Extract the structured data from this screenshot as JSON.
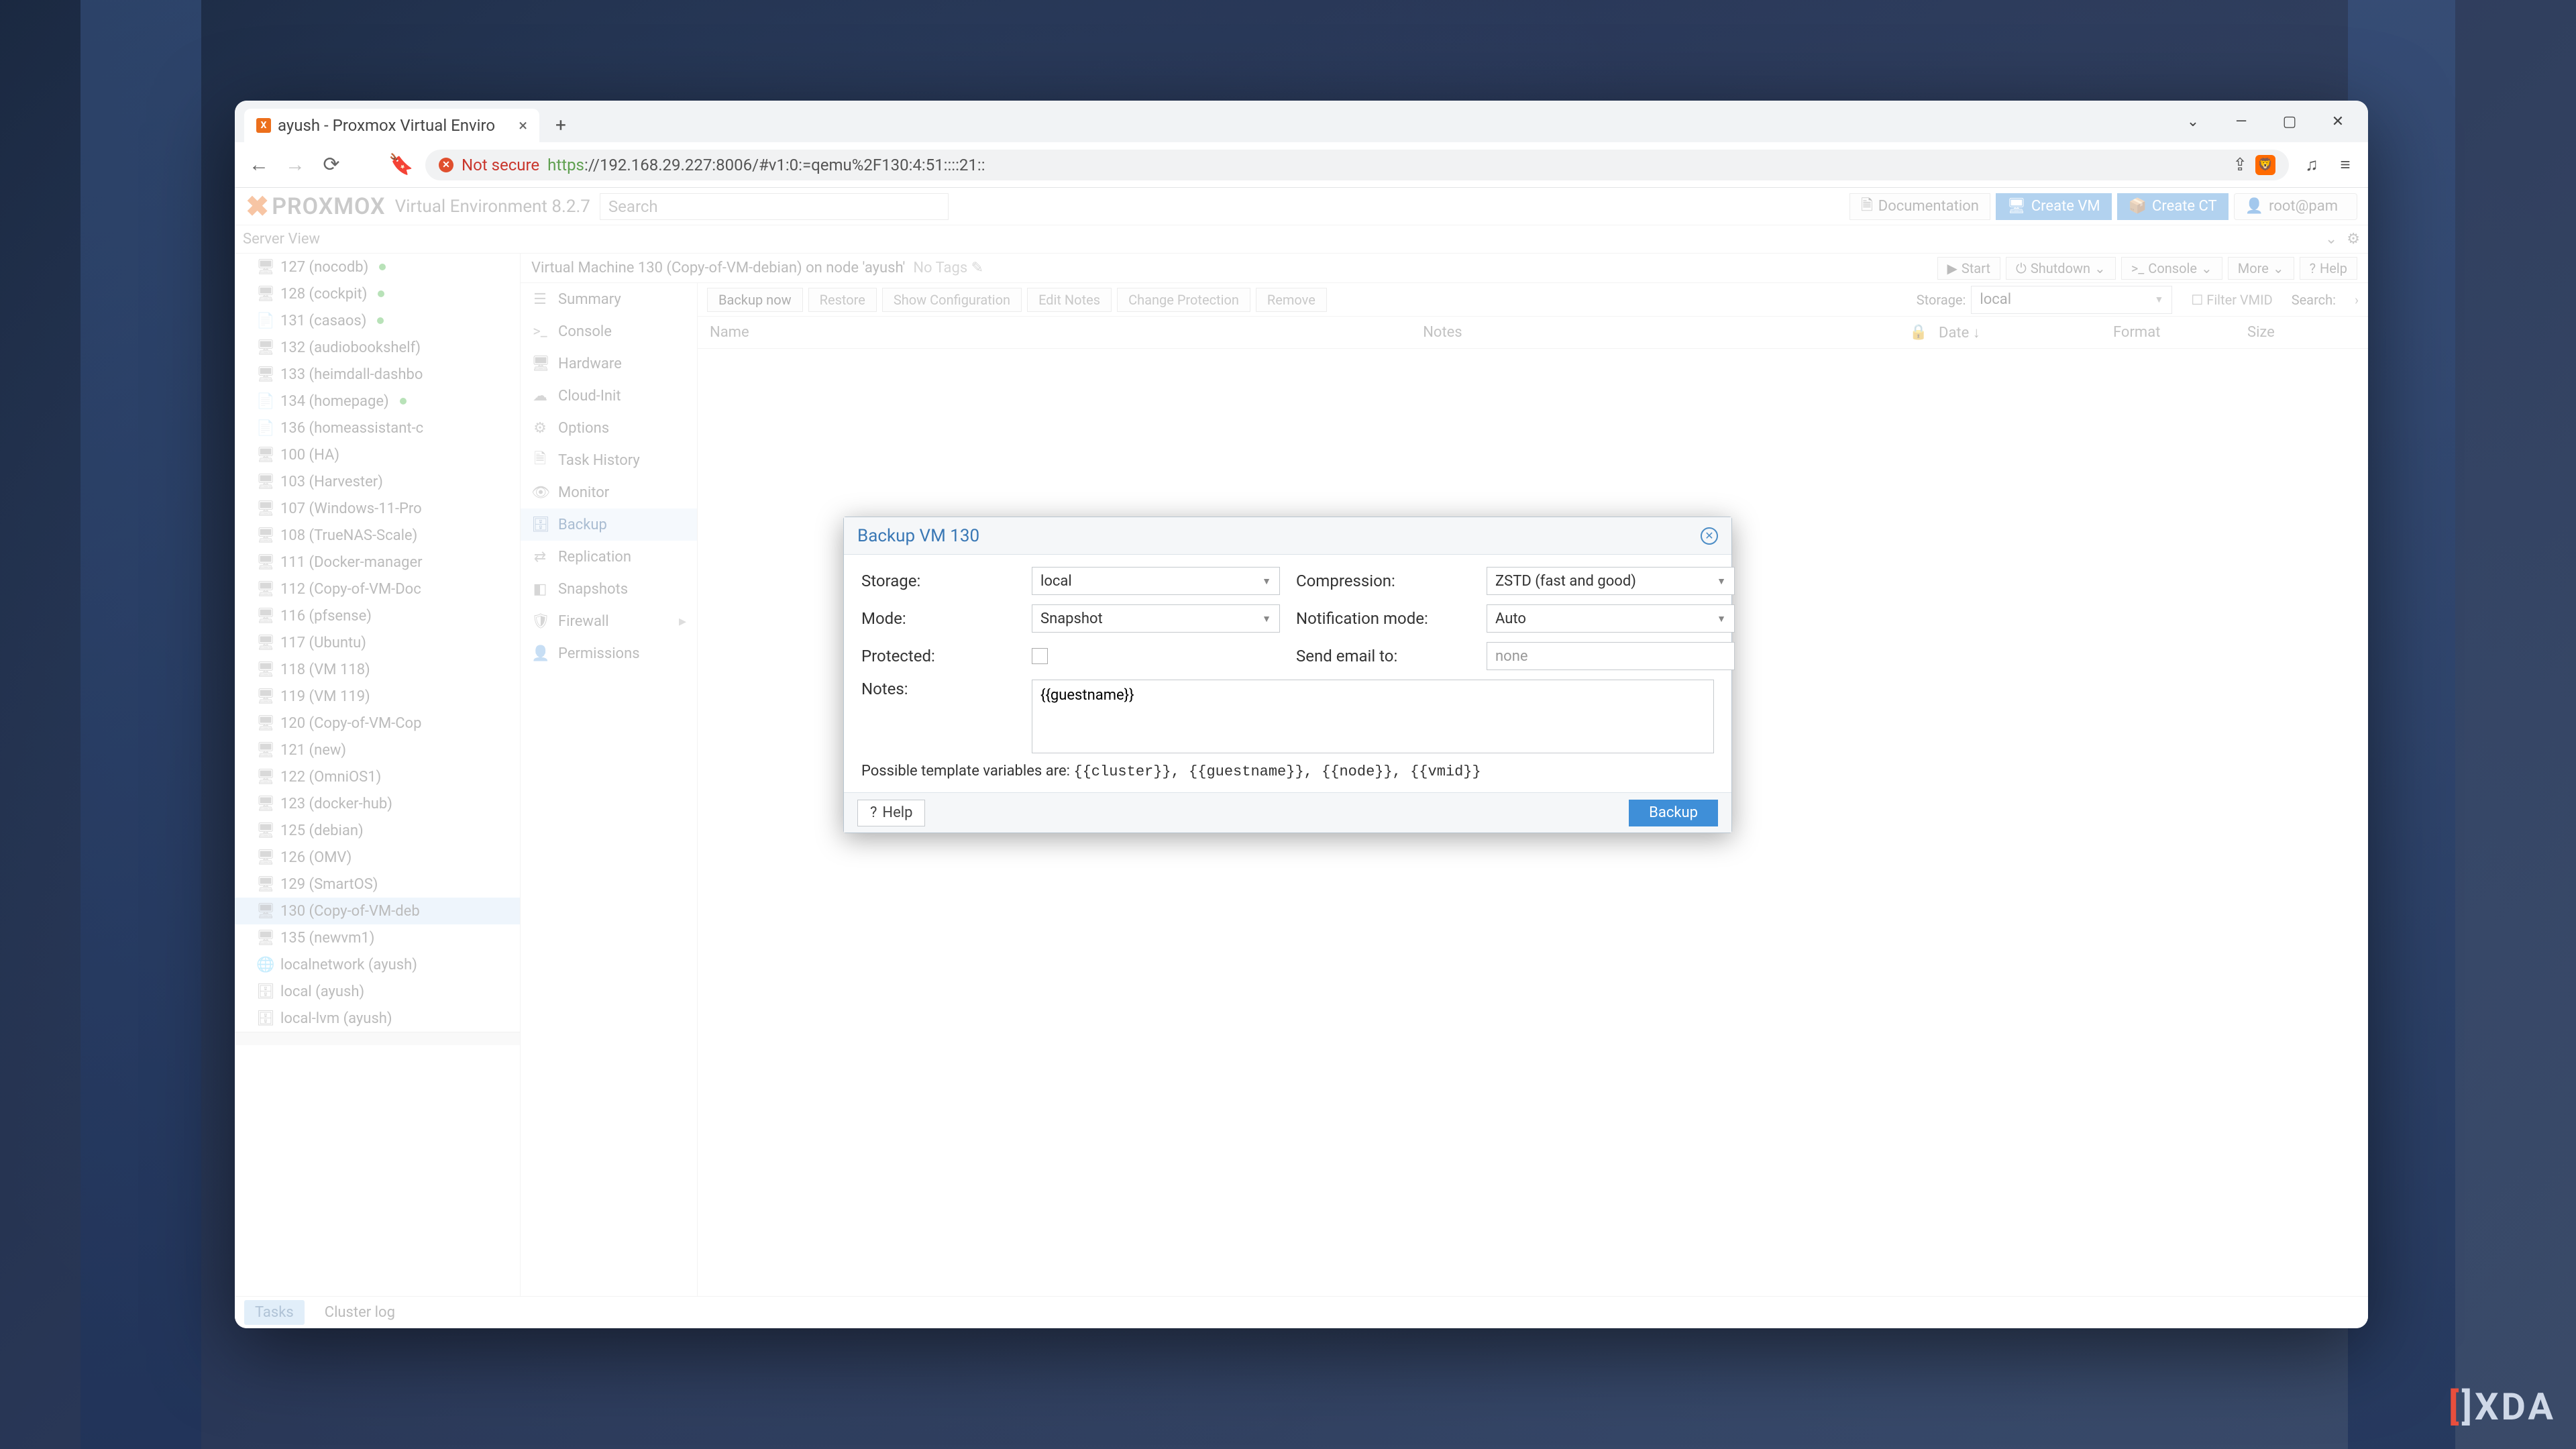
{
  "browser": {
    "tab_title": "ayush - Proxmox Virtual Enviro",
    "url_not_secure": "Not secure",
    "url_protocol": "https",
    "url_rest": "://192.168.29.227:8006/#v1:0:=qemu%2F130:4:51::::21::"
  },
  "pve": {
    "logo_brand": "PROXMOX",
    "version_label": "Virtual Environment 8.2.7",
    "search_placeholder": "Search",
    "btn_docs": "Documentation",
    "btn_create_vm": "Create VM",
    "btn_create_ct": "Create CT",
    "btn_user": "root@pam",
    "server_view": "Server View"
  },
  "tree": [
    {
      "label": "127 (nocodb)",
      "dot": true
    },
    {
      "label": "128 (cockpit)",
      "dot": true
    },
    {
      "label": "131 (casaos)",
      "dot": true,
      "tpl": true
    },
    {
      "label": "132 (audiobookshelf)"
    },
    {
      "label": "133 (heimdall-dashbo"
    },
    {
      "label": "134 (homepage)",
      "dot": true,
      "tpl": true
    },
    {
      "label": "136 (homeassistant-c",
      "tpl": true
    },
    {
      "label": "100 (HA)"
    },
    {
      "label": "103 (Harvester)"
    },
    {
      "label": "107 (Windows-11-Pro"
    },
    {
      "label": "108 (TrueNAS-Scale)"
    },
    {
      "label": "111 (Docker-manager"
    },
    {
      "label": "112 (Copy-of-VM-Doc"
    },
    {
      "label": "116 (pfsense)"
    },
    {
      "label": "117 (Ubuntu)"
    },
    {
      "label": "118 (VM 118)"
    },
    {
      "label": "119 (VM 119)"
    },
    {
      "label": "120 (Copy-of-VM-Cop"
    },
    {
      "label": "121 (new)"
    },
    {
      "label": "122 (OmniOS1)"
    },
    {
      "label": "123 (docker-hub)"
    },
    {
      "label": "125 (debian)"
    },
    {
      "label": "126 (OMV)"
    },
    {
      "label": "129 (SmartOS)"
    },
    {
      "label": "130 (Copy-of-VM-deb",
      "sel": true
    },
    {
      "label": "135 (newvm1)"
    },
    {
      "label": "localnetwork (ayush)",
      "net": true
    },
    {
      "label": "local (ayush)",
      "disk": true
    },
    {
      "label": "local-lvm (ayush)",
      "disk": true
    }
  ],
  "crumb": {
    "text": "Virtual Machine 130 (Copy-of-VM-debian) on node 'ayush'",
    "no_tags": "No Tags",
    "btn_start": "Start",
    "btn_shutdown": "Shutdown",
    "btn_console": "Console",
    "btn_more": "More",
    "btn_help": "Help"
  },
  "vmenu": [
    {
      "icon": "☰",
      "label": "Summary"
    },
    {
      "icon": ">_",
      "label": "Console"
    },
    {
      "icon": "🖥",
      "label": "Hardware"
    },
    {
      "icon": "☁",
      "label": "Cloud-Init"
    },
    {
      "icon": "⚙",
      "label": "Options"
    },
    {
      "icon": "🗎",
      "label": "Task History"
    },
    {
      "icon": "👁",
      "label": "Monitor"
    },
    {
      "icon": "🗄",
      "label": "Backup",
      "sel": true
    },
    {
      "icon": "⇄",
      "label": "Replication"
    },
    {
      "icon": "◧",
      "label": "Snapshots"
    },
    {
      "icon": "🛡",
      "label": "Firewall"
    },
    {
      "icon": "👤",
      "label": "Permissions"
    }
  ],
  "toolbar": {
    "backup_now": "Backup now",
    "restore": "Restore",
    "show_config": "Show Configuration",
    "edit_notes": "Edit Notes",
    "change_protection": "Change Protection",
    "remove": "Remove",
    "storage_label": "Storage:",
    "storage_value": "local",
    "filter_vmid": "Filter VMID",
    "search_label": "Search:"
  },
  "cols": {
    "name": "Name",
    "notes": "Notes",
    "date": "Date",
    "format": "Format",
    "size": "Size"
  },
  "footer": {
    "tasks": "Tasks",
    "cluster": "Cluster log"
  },
  "dialog": {
    "title": "Backup VM 130",
    "lbl_storage": "Storage:",
    "val_storage": "local",
    "lbl_mode": "Mode:",
    "val_mode": "Snapshot",
    "lbl_protected": "Protected:",
    "lbl_compression": "Compression:",
    "val_compression": "ZSTD (fast and good)",
    "lbl_notif": "Notification mode:",
    "val_notif": "Auto",
    "lbl_email": "Send email to:",
    "val_email": "none",
    "lbl_notes": "Notes:",
    "val_notes": "{{guestname}}",
    "hint_prefix": "Possible template variables are: ",
    "hint_vars": "{{cluster}}, {{guestname}}, {{node}}, {{vmid}}",
    "btn_help": "Help",
    "btn_backup": "Backup"
  }
}
